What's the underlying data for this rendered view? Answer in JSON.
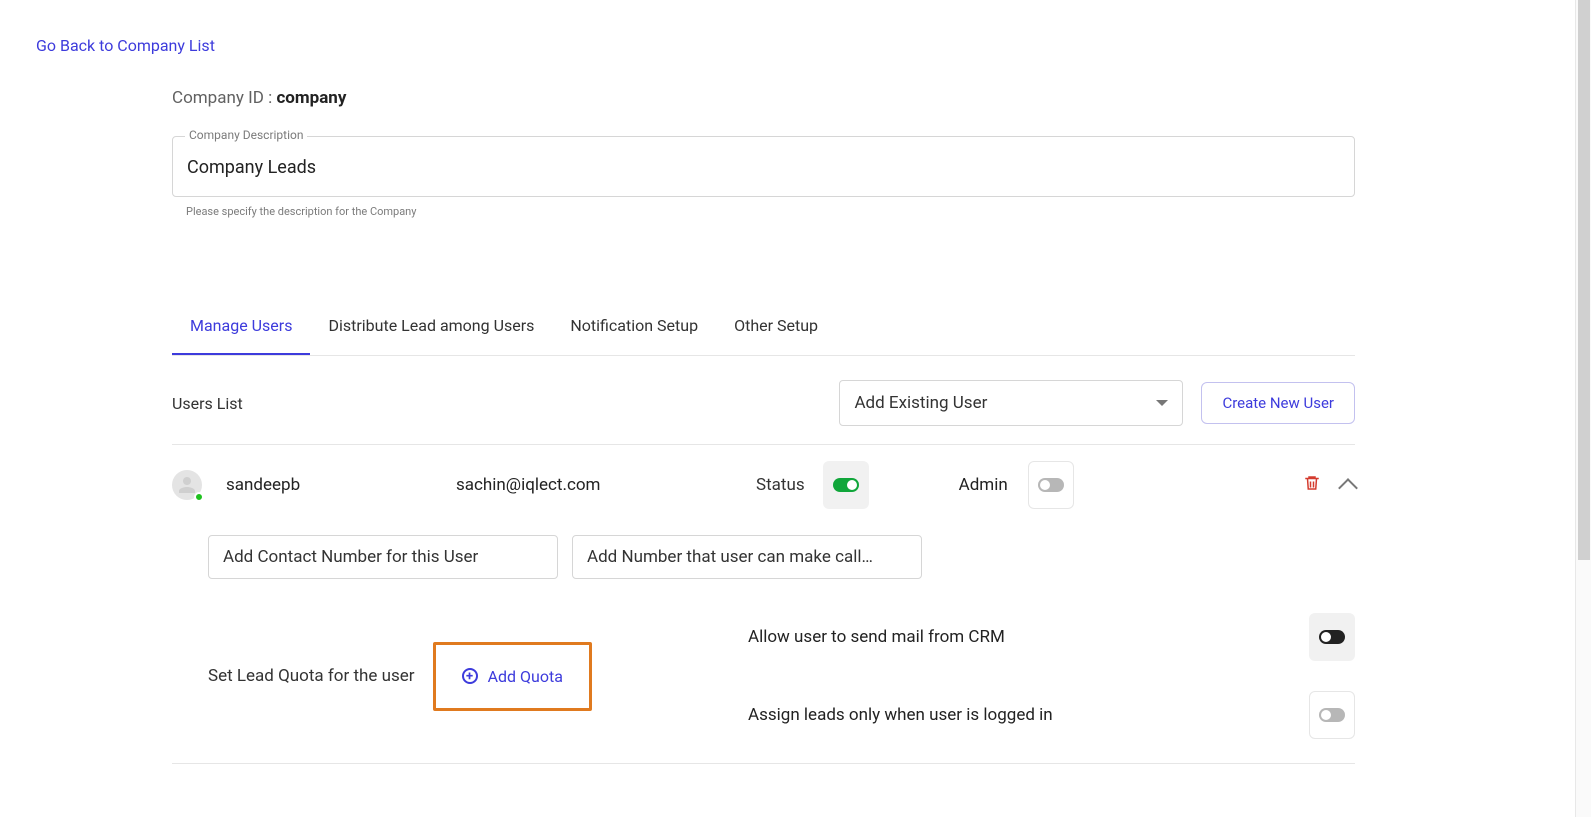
{
  "go_back": "Go Back to Company List",
  "company_id_label": "Company ID :",
  "company_id_value": "company",
  "description": {
    "label": "Company Description",
    "value": "Company Leads",
    "help": "Please specify the description for the Company"
  },
  "tabs": [
    {
      "label": "Manage Users",
      "active": true
    },
    {
      "label": "Distribute Lead among Users",
      "active": false
    },
    {
      "label": "Notification Setup",
      "active": false
    },
    {
      "label": "Other Setup",
      "active": false
    }
  ],
  "users_list_title": "Users List",
  "add_existing_placeholder": "Add Existing User",
  "create_new_user": "Create New User",
  "user": {
    "name": "sandeepb",
    "email": "sachin@iqlect.com",
    "status_label": "Status",
    "status_on": true,
    "admin_label": "Admin",
    "admin_on": false
  },
  "expand": {
    "contact_placeholder": "Add Contact Number for this User",
    "call_from_placeholder": "Add Number that user can make call…",
    "quota_label": "Set Lead Quota for the user",
    "add_quota": "Add Quota",
    "allow_mail": "Allow user to send mail from CRM",
    "assign_logged_in": "Assign leads only when user is logged in"
  }
}
